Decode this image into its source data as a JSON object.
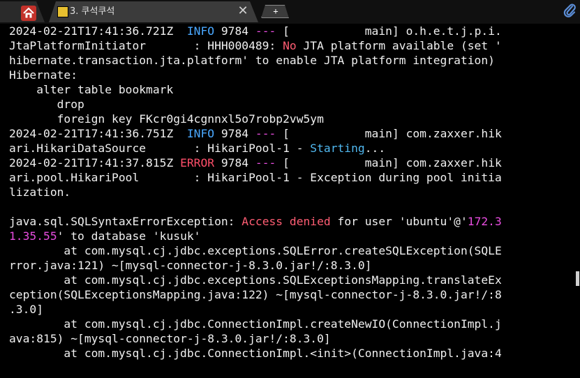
{
  "tabs": {
    "home_icon": "home-icon",
    "active_label": "3. 쿠석쿠석",
    "close_glyph": "✕",
    "new_tab_glyph": "+",
    "attach_icon": "paperclip-icon"
  },
  "terminal": {
    "l1": {
      "a": "2024-02-21T17:41:36.721Z  ",
      "b": "INFO",
      "c": " 9784 ",
      "d": "---",
      "e": " [           main] o.h.e.t.j.p.i."
    },
    "l2": {
      "a": "JtaPlatformInitiator       : HHH000489: ",
      "b": "No",
      "c": " JTA platform available (set '"
    },
    "l3": "hibernate.transaction.jta.platform' to enable JTA platform integration)",
    "l4": "Hibernate:",
    "l5": "    alter table bookmark",
    "l6": "       drop",
    "l7": "       foreign key FKcr0gi4cgnnxl5o7robp2vw5ym",
    "l8": {
      "a": "2024-02-21T17:41:36.751Z  ",
      "b": "INFO",
      "c": " 9784 ",
      "d": "---",
      "e": " [           main] com.zaxxer.hik"
    },
    "l9": {
      "a": "ari.HikariDataSource       : HikariPool-1 - ",
      "b": "Starting",
      "c": "..."
    },
    "l10": {
      "a": "2024-02-21T17:41:37.815Z ",
      "b": "ERROR",
      "c": " 9784 ",
      "d": "---",
      "e": " [           main] com.zaxxer.hik"
    },
    "l11": "ari.pool.HikariPool        : HikariPool-1 - Exception during pool initia",
    "l12": "lization.",
    "l13": "",
    "l14": {
      "a": "java.sql.SQLSyntaxErrorException: ",
      "b": "Access denied",
      "c": " for user 'ubuntu'@'",
      "d": "172.3"
    },
    "l15": {
      "a": "1.35.55",
      "b": "' to database 'kusuk'"
    },
    "l16": "        at com.mysql.cj.jdbc.exceptions.SQLError.createSQLException(SQLE",
    "l17": "rror.java:121) ~[mysql-connector-j-8.3.0.jar!/:8.3.0]",
    "l18": "        at com.mysql.cj.jdbc.exceptions.SQLExceptionsMapping.translateEx",
    "l19": "ception(SQLExceptionsMapping.java:122) ~[mysql-connector-j-8.3.0.jar!/:8",
    "l20": ".3.0]",
    "l21": "        at com.mysql.cj.jdbc.ConnectionImpl.createNewIO(ConnectionImpl.j",
    "l22": "ava:815) ~[mysql-connector-j-8.3.0.jar!/:8.3.0]",
    "l23": "        at com.mysql.cj.jdbc.ConnectionImpl.<init>(ConnectionImpl.java:4"
  },
  "colors": {
    "info": "#4aa8ff",
    "error": "#ff4f6a",
    "highlight": "#ff5d73",
    "ip": "#e84de0",
    "starting": "#50b8f0",
    "text": "#f0f0f0",
    "background": "#000000"
  }
}
